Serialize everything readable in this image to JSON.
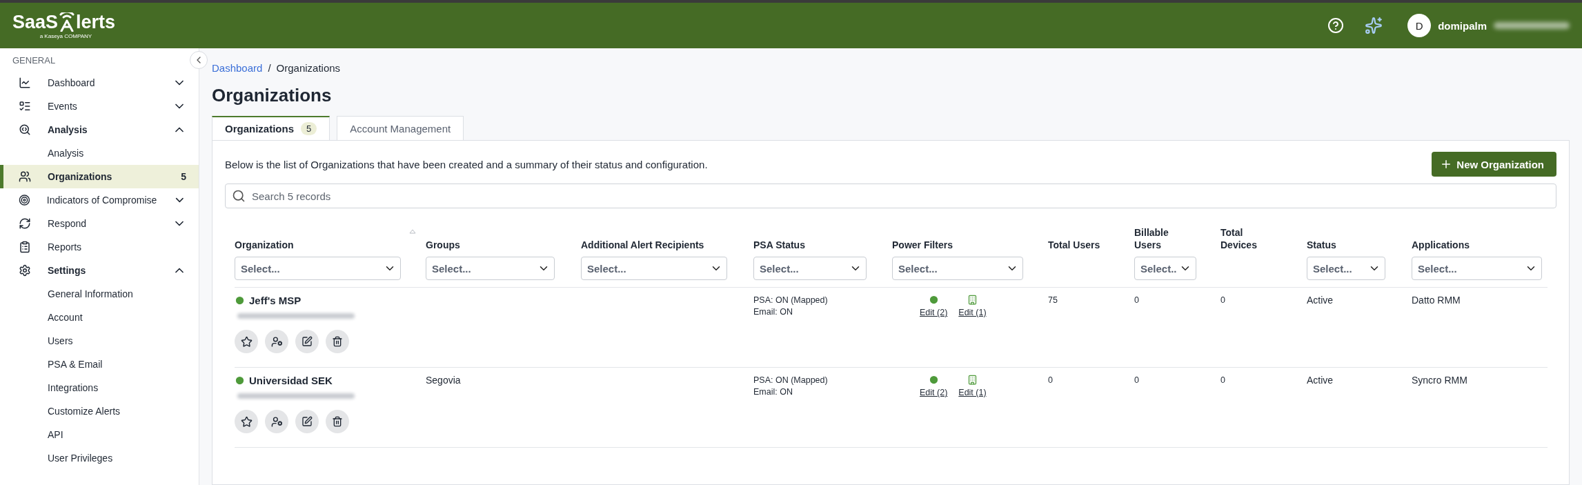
{
  "header": {
    "logo_left": "SaaS",
    "logo_right": "lerts",
    "logo_sub": "a Kaseya COMPANY",
    "avatar_initial": "D",
    "user_name": "domipalm"
  },
  "sidebar": {
    "section": "GENERAL",
    "items": [
      {
        "label": "Dashboard",
        "kind": "group",
        "expanded": false,
        "selected": false
      },
      {
        "label": "Events",
        "kind": "group",
        "expanded": false,
        "selected": false
      },
      {
        "label": "Analysis",
        "kind": "group",
        "expanded": true,
        "selected": false
      },
      {
        "label": "Analysis",
        "kind": "sub",
        "selected": false
      },
      {
        "label": "Organizations",
        "kind": "link",
        "selected": true,
        "badge": "5"
      },
      {
        "label": "Indicators of Compromise",
        "kind": "group",
        "expanded": false,
        "selected": false
      },
      {
        "label": "Respond",
        "kind": "group",
        "expanded": false,
        "selected": false
      },
      {
        "label": "Reports",
        "kind": "link",
        "selected": false
      },
      {
        "label": "Settings",
        "kind": "group",
        "expanded": true,
        "selected": false
      },
      {
        "label": "General Information",
        "kind": "sub",
        "selected": false
      },
      {
        "label": "Account",
        "kind": "sub",
        "selected": false
      },
      {
        "label": "Users",
        "kind": "sub",
        "selected": false
      },
      {
        "label": "PSA & Email",
        "kind": "sub",
        "selected": false
      },
      {
        "label": "Integrations",
        "kind": "sub",
        "selected": false
      },
      {
        "label": "Customize Alerts",
        "kind": "sub",
        "selected": false
      },
      {
        "label": "API",
        "kind": "sub",
        "selected": false
      },
      {
        "label": "User Privileges",
        "kind": "sub",
        "selected": false
      }
    ]
  },
  "breadcrumb": {
    "link": "Dashboard",
    "separator": "/",
    "current": "Organizations"
  },
  "title": "Organizations",
  "tabs": [
    {
      "label": "Organizations",
      "badge": "5",
      "selected": true
    },
    {
      "label": "Account Management",
      "selected": false
    }
  ],
  "description": "Below is the list of Organizations that have been created and a summary of their status and configuration.",
  "new_button": "New Organization",
  "search": {
    "placeholder": "Search 5 records"
  },
  "table": {
    "columns": [
      {
        "label": "Organization",
        "filter": "Select...",
        "sortable": true
      },
      {
        "label": "Groups",
        "filter": "Select..."
      },
      {
        "label": "Additional Alert Recipients",
        "filter": "Select..."
      },
      {
        "label": "PSA Status",
        "filter": "Select..."
      },
      {
        "label": "Power Filters",
        "filter": "Select..."
      },
      {
        "label": "Total Users"
      },
      {
        "label": "Billable Users",
        "filter": "Select.."
      },
      {
        "label": "Total Devices"
      },
      {
        "label": "Status",
        "filter": "Select..."
      },
      {
        "label": "Applications",
        "filter": "Select..."
      }
    ],
    "rows": [
      {
        "name": "Jeff's MSP",
        "groups": "",
        "psa": [
          "PSA: ON (Mapped)",
          "Email: ON"
        ],
        "power_filters": [
          "Edit (2)",
          "Edit (1)"
        ],
        "total_users": "75",
        "billable_users": "0",
        "total_devices": "0",
        "status": "Active",
        "applications": "Datto RMM"
      },
      {
        "name": "Universidad SEK",
        "groups": "Segovia",
        "psa": [
          "PSA: ON (Mapped)",
          "Email: ON"
        ],
        "power_filters": [
          "Edit (2)",
          "Edit (1)"
        ],
        "total_users": "0",
        "billable_users": "0",
        "total_devices": "0",
        "status": "Active",
        "applications": "Syncro RMM"
      }
    ]
  }
}
